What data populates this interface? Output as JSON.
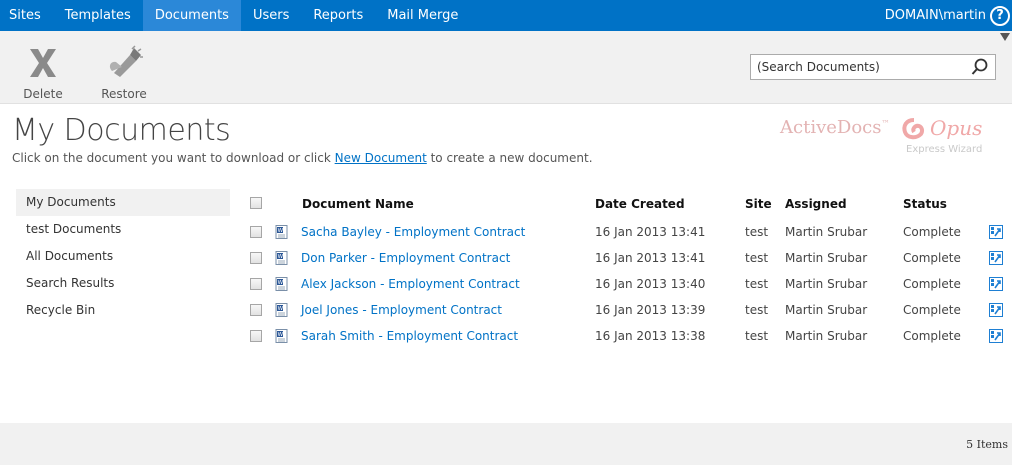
{
  "nav": {
    "items": [
      {
        "label": "Sites"
      },
      {
        "label": "Templates"
      },
      {
        "label": "Documents"
      },
      {
        "label": "Users"
      },
      {
        "label": "Reports"
      },
      {
        "label": "Mail Merge"
      }
    ],
    "active": "Documents",
    "user": "DOMAIN\\martin",
    "help_glyph": "?"
  },
  "ribbon": {
    "delete_label": "Delete",
    "restore_label": "Restore",
    "search_placeholder": "(Search Documents)"
  },
  "page": {
    "title": "My Documents",
    "subtitle_before": "Click on the document you want to download or click ",
    "subtitle_link": "New Document",
    "subtitle_after": " to create a new document."
  },
  "logo": {
    "brand": "ActiveDocs",
    "trademark": "™",
    "opus": "Opus",
    "express": "Express Wizard"
  },
  "leftnav": {
    "items": [
      {
        "label": "My Documents"
      },
      {
        "label": "test Documents"
      },
      {
        "label": "All Documents"
      },
      {
        "label": "Search Results"
      },
      {
        "label": "Recycle Bin"
      }
    ]
  },
  "table": {
    "headers": {
      "name": "Document Name",
      "date": "Date Created",
      "site": "Site",
      "assigned": "Assigned",
      "status": "Status"
    },
    "rows": [
      {
        "name": "Sacha Bayley - Employment Contract",
        "date": "16 Jan 2013 13:41",
        "site": "test",
        "assigned": "Martin Srubar",
        "status": "Complete"
      },
      {
        "name": "Don Parker - Employment Contract",
        "date": "16 Jan 2013 13:41",
        "site": "test",
        "assigned": "Martin Srubar",
        "status": "Complete"
      },
      {
        "name": "Alex Jackson - Employment Contract",
        "date": "16 Jan 2013 13:40",
        "site": "test",
        "assigned": "Martin Srubar",
        "status": "Complete"
      },
      {
        "name": "Joel Jones - Employment Contract",
        "date": "16 Jan 2013 13:39",
        "site": "test",
        "assigned": "Martin Srubar",
        "status": "Complete"
      },
      {
        "name": "Sarah Smith - Employment Contract",
        "date": "16 Jan 2013 13:38",
        "site": "test",
        "assigned": "Martin Srubar",
        "status": "Complete"
      }
    ]
  },
  "footer": {
    "count": "5 Items"
  },
  "colors": {
    "accent": "#0072c6",
    "nav_active": "#2b88d8",
    "panel": "#f1f1f1"
  }
}
